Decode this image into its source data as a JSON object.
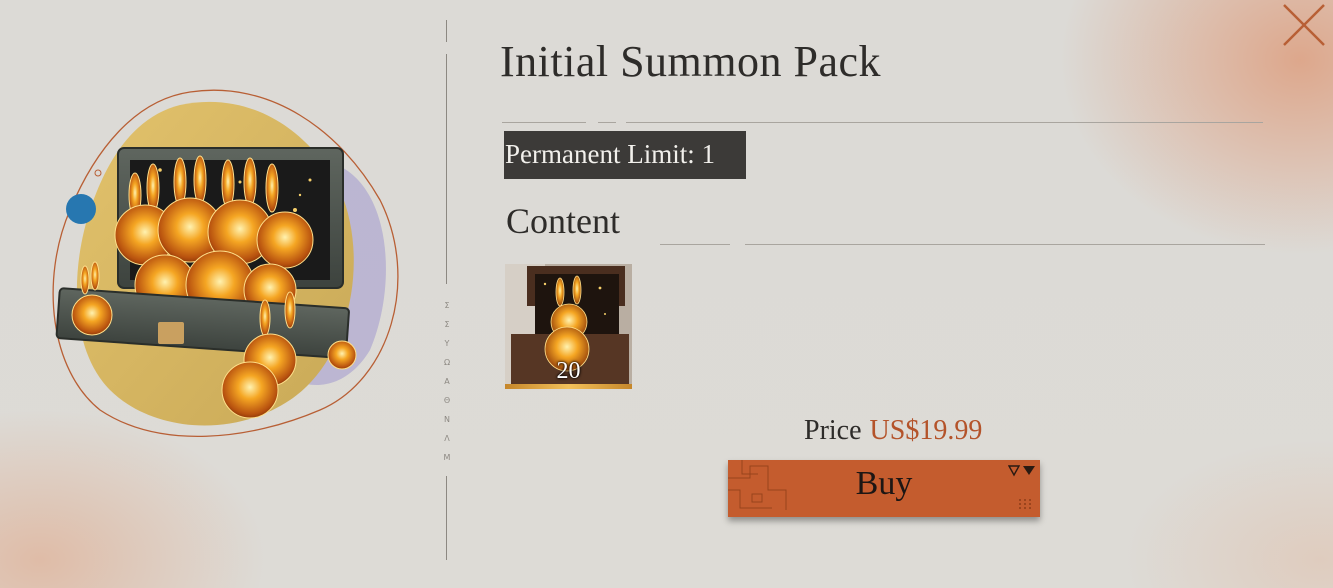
{
  "pack": {
    "title": "Initial Summon Pack",
    "limit": "Permanent Limit: 1",
    "content_heading": "Content",
    "item": {
      "icon": "rabbit-chest-icon",
      "quantity": "20"
    },
    "price_label": "Price",
    "price_value": "US$19.99",
    "buy_label": "Buy"
  },
  "divider_text": [
    "Σ",
    "Σ",
    "Y",
    "Ω",
    "A",
    "Θ",
    "N",
    "Λ",
    "M"
  ],
  "colors": {
    "accent": "#c45c2e",
    "price": "#b4532a",
    "limit_bg": "#3c3a38",
    "text": "#2e2c2a"
  }
}
